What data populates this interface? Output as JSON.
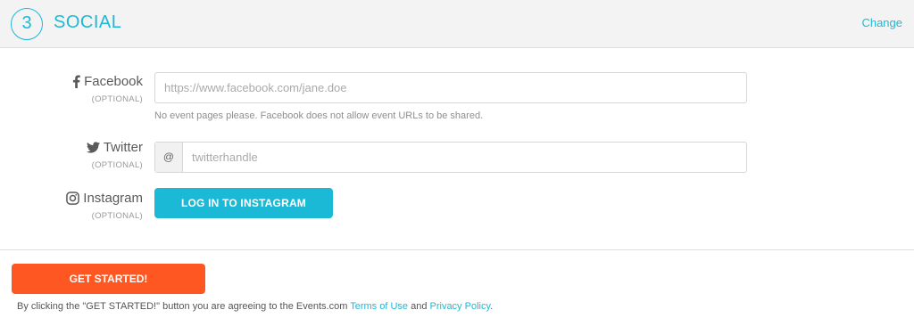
{
  "header": {
    "step_number": "3",
    "title": "SOCIAL",
    "change_label": "Change"
  },
  "facebook": {
    "label": "Facebook",
    "optional": "(OPTIONAL)",
    "placeholder": "https://www.facebook.com/jane.doe",
    "value": "",
    "hint": "No event pages please. Facebook does not allow event URLs to be shared.",
    "icon": "facebook-icon"
  },
  "twitter": {
    "label": "Twitter",
    "optional": "(OPTIONAL)",
    "prefix": "@",
    "placeholder": "twitterhandle",
    "value": "",
    "icon": "twitter-icon"
  },
  "instagram": {
    "label": "Instagram",
    "optional": "(OPTIONAL)",
    "button_label": "LOG IN TO INSTAGRAM",
    "icon": "instagram-icon"
  },
  "footer": {
    "cta_label": "GET STARTED!",
    "legal_prefix": "By clicking the \"GET STARTED!\" button you are agreeing to the Events.com ",
    "terms_label": "Terms of Use",
    "legal_and": " and ",
    "privacy_label": "Privacy Policy",
    "legal_suffix": "."
  },
  "colors": {
    "accent": "#1cb9d6",
    "cta": "#ff5722",
    "header_bg": "#f3f3f3"
  }
}
